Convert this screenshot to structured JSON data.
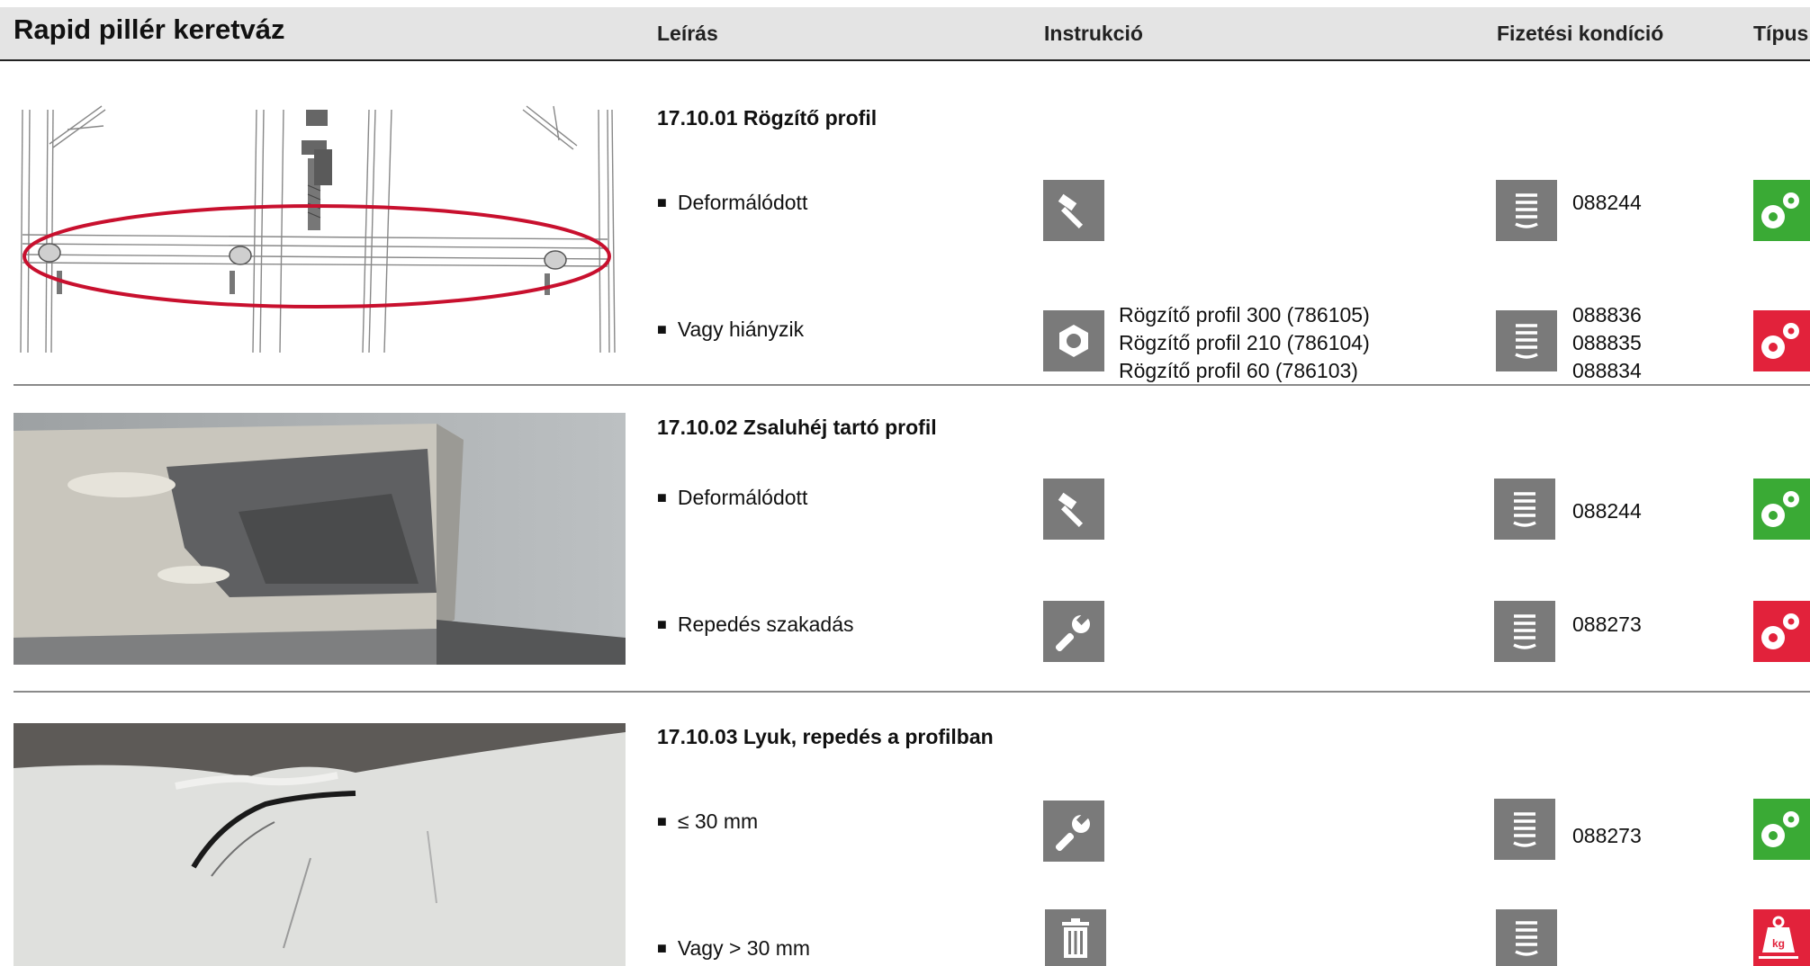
{
  "header": {
    "title": "Rapid pillér keretváz",
    "col_leiras": "Leírás",
    "col_instrukcio": "Instrukció",
    "col_fizetesi": "Fizetési kondíció",
    "col_tipus": "Típus"
  },
  "sections": [
    {
      "title": "17.10.01 Rögzítő profil",
      "rows": [
        {
          "label": "Deformálódott",
          "instr_icon": "hammer-icon",
          "instr_lines": [],
          "codes": [
            "088244"
          ],
          "type_icon": "gears-icon",
          "type_color": "#3aaa35"
        },
        {
          "label": "Vagy hiányzik",
          "instr_icon": "nut-icon",
          "instr_lines": [
            "Rögzítő profil 300 (786105)",
            "Rögzítő profil 210 (786104)",
            "Rögzítő profil 60 (786103)"
          ],
          "codes": [
            "088836",
            "088835",
            "088834"
          ],
          "type_icon": "gears-icon",
          "type_color": "#e2223b"
        }
      ]
    },
    {
      "title": "17.10.02 Zsaluhéj tartó profil",
      "rows": [
        {
          "label": "Deformálódott",
          "instr_icon": "hammer-icon",
          "instr_lines": [],
          "codes": [
            "088244"
          ],
          "type_icon": "gears-icon",
          "type_color": "#3aaa35"
        },
        {
          "label": "Repedés szakadás",
          "instr_icon": "wrench-icon",
          "instr_lines": [],
          "codes": [
            "088273"
          ],
          "type_icon": "gears-icon",
          "type_color": "#e2223b"
        }
      ]
    },
    {
      "title": "17.10.03 Lyuk, repedés a profilban",
      "rows": [
        {
          "label": "≤ 30 mm",
          "instr_icon": "wrench-icon",
          "instr_lines": [],
          "codes": [
            "088273"
          ],
          "type_icon": "gears-icon",
          "type_color": "#3aaa35"
        },
        {
          "label": "Vagy > 30 mm",
          "instr_icon": "trash-icon",
          "instr_lines": [],
          "codes": [],
          "type_icon": "weight-kg-icon",
          "type_color": "#e2223b"
        }
      ]
    }
  ],
  "icons": {
    "payment": "coin-stack-icon",
    "weight_label": "kg"
  },
  "colors": {
    "header_bg": "#e4e4e4",
    "icon_gray": "#7a7a7a",
    "ok_green": "#3aaa35",
    "scrap_red": "#e2223b",
    "highlight_ellipse": "#c8102e"
  }
}
